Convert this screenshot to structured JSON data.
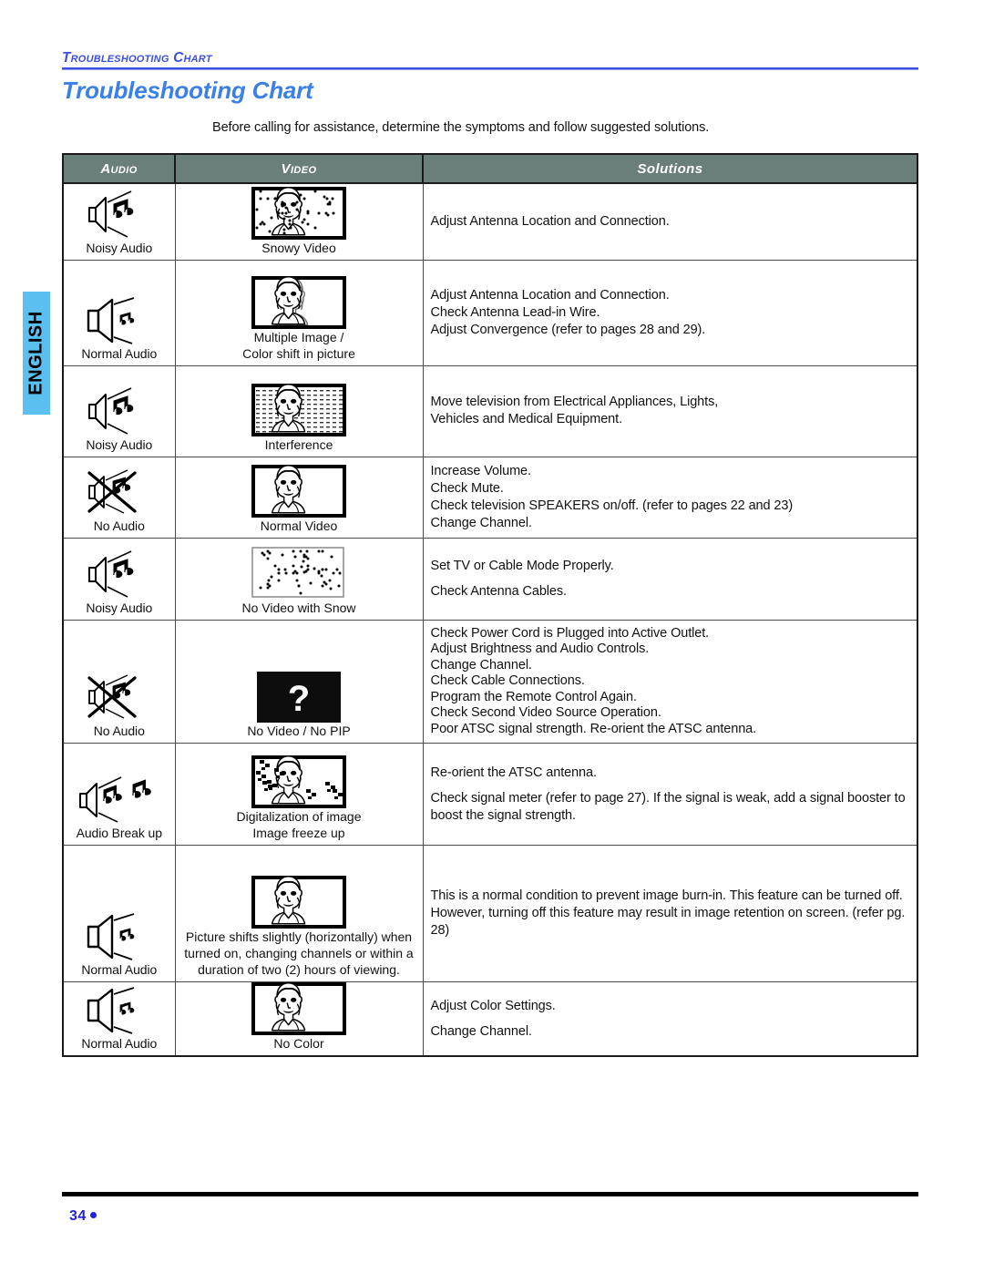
{
  "sidebar": {
    "language_tab": "ENGLISH"
  },
  "header": {
    "running_head": "Troubleshooting Chart",
    "title": "Troubleshooting Chart",
    "intro": "Before calling for assistance, determine the symptoms and follow suggested solutions."
  },
  "table": {
    "columns": [
      {
        "key": "audio",
        "label": "Audio"
      },
      {
        "key": "video",
        "label": "Video"
      },
      {
        "key": "solutions",
        "label": "Solutions"
      }
    ],
    "rows": [
      {
        "audio_icon": "speaker-noisy-icon",
        "audio_label": "Noisy Audio",
        "video_icon": "tv-snowy-icon",
        "video_label": "Snowy Video",
        "video_label2": "",
        "solutions": [
          "Adjust Antenna Location and Connection."
        ]
      },
      {
        "audio_icon": "speaker-normal-icon",
        "audio_label": "Normal Audio",
        "video_icon": "tv-multiple-image-icon",
        "video_label": "Multiple Image /",
        "video_label2": "Color shift in picture",
        "solutions": [
          "Adjust Antenna Location and Connection.",
          "Check Antenna Lead-in Wire.",
          "Adjust Convergence (refer to pages 28 and 29)."
        ]
      },
      {
        "audio_icon": "speaker-noisy-icon",
        "audio_label": "Noisy Audio",
        "video_icon": "tv-interference-icon",
        "video_label": "Interference",
        "video_label2": "",
        "solutions": [
          "Move television from Electrical Appliances, Lights,",
          "Vehicles and Medical Equipment."
        ]
      },
      {
        "audio_icon": "speaker-muted-icon",
        "audio_label": "No Audio",
        "video_icon": "tv-normal-icon",
        "video_label": "Normal Video",
        "video_label2": "",
        "solutions": [
          "Increase Volume.",
          "Check Mute.",
          "Check television SPEAKERS on/off. (refer to pages 22 and 23)",
          "Change Channel."
        ]
      },
      {
        "audio_icon": "speaker-noisy-icon",
        "audio_label": "Noisy Audio",
        "video_icon": "tv-snow-only-icon",
        "video_label": "No Video with Snow",
        "video_label2": "",
        "solutions": [
          "Set TV or Cable Mode Properly.",
          "Check Antenna Cables."
        ]
      },
      {
        "audio_icon": "speaker-muted-icon",
        "audio_label": "No Audio",
        "video_icon": "tv-question-mark-icon",
        "video_label": "No Video / No PIP",
        "video_label2": "",
        "solutions": [
          "Check Power Cord is Plugged into Active Outlet.",
          "Adjust Brightness and Audio Controls.",
          "Change Channel.",
          "Check Cable Connections.",
          "Program the Remote Control Again.",
          "Check Second Video Source Operation.",
          "Poor ATSC signal strength. Re-orient the ATSC antenna."
        ]
      },
      {
        "audio_icon": "speaker-breakup-icon",
        "audio_label": "Audio Break up",
        "video_icon": "tv-digitalization-icon",
        "video_label": "Digitalization of image",
        "video_label2": "Image freeze up",
        "solutions": [
          "Re-orient the ATSC antenna.",
          "Check signal meter (refer to page 27). If the signal is weak, add a signal booster to boost the signal strength."
        ]
      },
      {
        "audio_icon": "speaker-normal-icon",
        "audio_label": "Normal Audio",
        "video_icon": "tv-normal-icon",
        "video_label": "Picture shifts slightly (horizontally) when turned on, changing channels or within a duration of two (2) hours of viewing.",
        "video_label2": "",
        "solutions": [
          "This is a normal condition to prevent image burn-in. This feature can be turned off. However, turning off this feature may result in image retention on screen. (refer pg. 28)"
        ]
      },
      {
        "audio_icon": "speaker-normal-icon",
        "audio_label": "Normal Audio",
        "video_icon": "tv-no-color-icon",
        "video_label": "No Color",
        "video_label2": "",
        "solutions": [
          "Adjust Color Settings.",
          "Change Channel."
        ]
      }
    ]
  },
  "footer": {
    "page_number": "34"
  },
  "colors": {
    "title_blue": "#3b7fe8",
    "runhead_blue": "#3b4fe0",
    "header_bg": "#6b7f7a",
    "tab_blue": "#5bc0f0",
    "footer_blue": "#2222dd"
  }
}
